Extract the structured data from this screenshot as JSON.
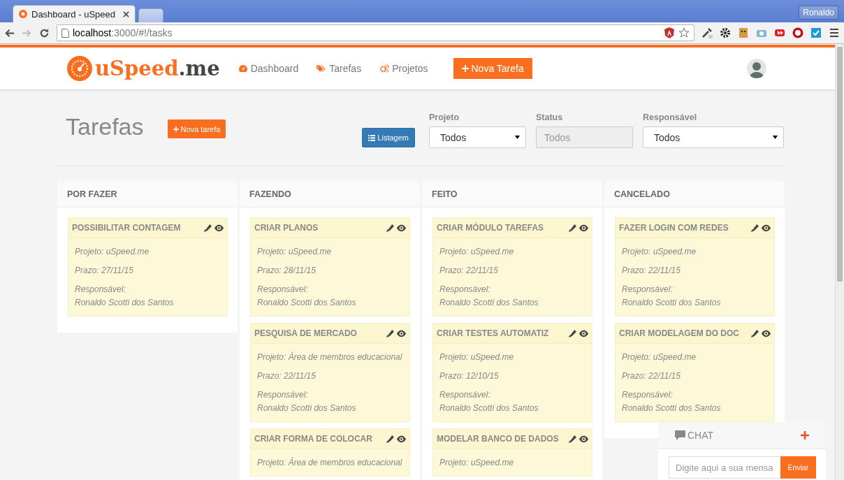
{
  "browser": {
    "tabs": [
      {
        "title": "Dashboard - uSpeed",
        "selected": true
      },
      {
        "selected": false
      }
    ],
    "profile": "Ronaldo",
    "url_host": "localhost",
    "url_path": ":3000/#!/tasks"
  },
  "app": {
    "logo_main": "uSpeed",
    "logo_suffix": ".me",
    "nav": [
      {
        "label": "Dashboard",
        "kind": "dashboard"
      },
      {
        "label": "Tarefas",
        "kind": "tasks"
      },
      {
        "label": "Projetos",
        "kind": "projects"
      }
    ],
    "cta": "Nova Tarefa"
  },
  "page": {
    "title": "Tarefas",
    "new_button": "Nova tarefa",
    "view_button": "Listagem",
    "filters": [
      {
        "label": "Projeto",
        "value": "Todos",
        "disabled": false
      },
      {
        "label": "Status",
        "value": "Todos",
        "disabled": true
      },
      {
        "label": "Responsável",
        "value": "Todos",
        "disabled": false
      }
    ]
  },
  "columns": [
    {
      "title": "POR FAZER",
      "cards": [
        {
          "title": "POSSIBILITAR CONTAGEM",
          "project": "Projeto: uSpeed.me",
          "deadline": "Prazo: 27/11/15",
          "assignee_label": "Responsável:",
          "assignee": "Ronaldo Scotti dos Santos"
        }
      ]
    },
    {
      "title": "FAZENDO",
      "cards": [
        {
          "title": "CRIAR PLANOS",
          "project": "Projeto: uSpeed.me",
          "deadline": "Prazo: 28/11/15",
          "assignee_label": "Responsável:",
          "assignee": "Ronaldo Scotti dos Santos"
        },
        {
          "title": "PESQUISA DE MERCADO",
          "project": "Projeto: Área de membros educacional",
          "deadline": "Prazo: 22/11/15",
          "assignee_label": "Responsável:",
          "assignee": "Ronaldo Scotti dos Santos"
        },
        {
          "title": "CRIAR FORMA DE COLOCAR",
          "project": "Projeto: Área de membros educacional"
        }
      ]
    },
    {
      "title": "FEITO",
      "cards": [
        {
          "title": "CRIAR MÓDULO TAREFAS",
          "project": "Projeto: uSpeed.me",
          "deadline": "Prazo: 22/11/15",
          "assignee_label": "Responsável:",
          "assignee": "Ronaldo Scotti dos Santos"
        },
        {
          "title": "CRIAR TESTES AUTOMATIZ",
          "project": "Projeto: uSpeed.me",
          "deadline": "Prazo: 12/10/15",
          "assignee_label": "Responsável:",
          "assignee": "Ronaldo Scotti dos Santos"
        },
        {
          "title": "MODELAR BANCO DE DADOS",
          "project": "Projeto: uSpeed.me"
        }
      ]
    },
    {
      "title": "CANCELADO",
      "cards": [
        {
          "title": "FAZER LOGIN COM REDES",
          "project": "Projeto: uSpeed.me",
          "deadline": "Prazo: 22/11/15",
          "assignee_label": "Responsável:",
          "assignee": "Ronaldo Scotti dos Santos"
        },
        {
          "title": "CRIAR MODELAGEM DO DOC",
          "project": "Projeto: uSpeed.me",
          "deadline": "Prazo: 22/11/15",
          "assignee_label": "Responsável:",
          "assignee": "Ronaldo Scotti dos Santos"
        }
      ]
    }
  ],
  "chat": {
    "title": "CHAT",
    "placeholder": "Digite aqui a sua mensa",
    "send": "Enviar"
  }
}
